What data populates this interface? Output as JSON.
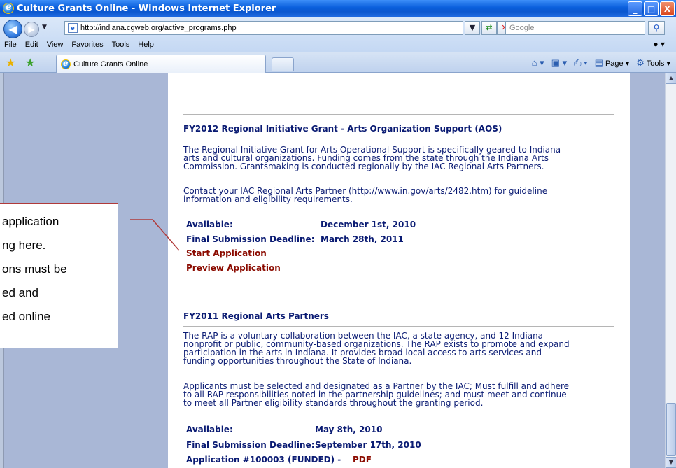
{
  "window": {
    "title": "Culture Grants Online - Windows Internet Explorer",
    "minimize": "_",
    "maximize": "□",
    "close": "X"
  },
  "address": {
    "url": "http://indiana.cgweb.org/active_programs.php",
    "search_placeholder": "Google"
  },
  "menu": [
    "File",
    "Edit",
    "View",
    "Favorites",
    "Tools",
    "Help"
  ],
  "tab": {
    "label": "Culture Grants Online"
  },
  "commands": {
    "page": "Page",
    "tools": "Tools"
  },
  "sections": [
    {
      "title": "FY2012 Regional Initiative Grant - Arts Organization Support (AOS)",
      "paragraphs": [
        [
          "The Regional Initiative Grant for Arts Operational Support is specifically geared to Indiana",
          "arts and cultural organizations. Funding comes from the state through the Indiana Arts",
          "Commission. Grantsmaking is conducted regionally by the IAC Regional Arts Partners."
        ],
        [
          "Contact your IAC Regional Arts Partner (http://www.in.gov/arts/2482.htm) for guideline",
          "information and eligibility requirements."
        ]
      ],
      "available_label": "Available:",
      "available_value": "December 1st, 2010",
      "deadline_label": "Final Submission Deadline:",
      "deadline_value": "March 28th, 2011",
      "links": [
        "Start Application",
        "Preview Application"
      ]
    },
    {
      "title": "FY2011 Regional Arts Partners",
      "paragraphs": [
        [
          "The RAP is a voluntary collaboration between the IAC, a state agency, and 12 Indiana",
          "nonprofit or public, community-based organizations. The RAP exists to promote and expand",
          "participation in the arts in Indiana. It provides broad local access to arts services and",
          "funding opportunities throughout the State of Indiana."
        ],
        [
          "Applicants must be selected and designated as a Partner by the IAC; Must fulfill and adhere",
          "to all RAP responsibilities noted in the partnership guidelines; and must meet and continue",
          "to meet all Partner eligibility standards throughout the granting period."
        ]
      ],
      "available_label": "Available:",
      "available_value": "May 8th, 2010",
      "deadline_label": "Final Submission Deadline:",
      "deadline_value": "September 17th, 2010",
      "application_label": "Application #100003 (FUNDED) -",
      "pdf_link": "PDF"
    }
  ],
  "callout": {
    "lines": [
      "application",
      "ng here.",
      "ons must be",
      "ed and",
      "ed online"
    ]
  }
}
